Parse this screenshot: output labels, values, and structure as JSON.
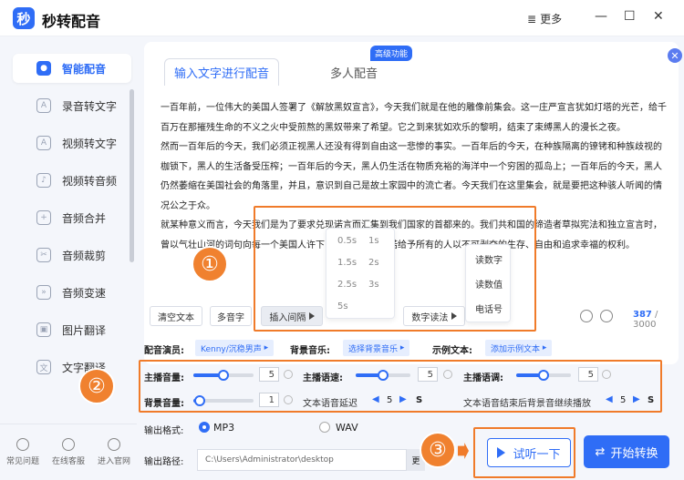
{
  "app": {
    "title": "秒转配音",
    "logo_char": "秒",
    "more_label": "更多",
    "win_min": "—",
    "win_max": "☐",
    "win_close": "✕"
  },
  "sidebar": {
    "items": [
      {
        "label": "智能配音",
        "active": true
      },
      {
        "label": "录音转文字"
      },
      {
        "label": "视频转文字"
      },
      {
        "label": "视频转音频"
      },
      {
        "label": "音频合并"
      },
      {
        "label": "音频裁剪"
      },
      {
        "label": "音频变速"
      },
      {
        "label": "图片翻译"
      },
      {
        "label": "文字翻译"
      }
    ],
    "bottom": [
      "常见问题",
      "在线客服",
      "进入官网"
    ]
  },
  "tabs": {
    "input_text": "输入文字进行配音",
    "multi": "多人配音",
    "badge": "高级功能"
  },
  "body_text": [
    "一百年前，一位伟大的美国人签署了《解放黑奴宣言》，今天我们就是在他的雕像前集会。这一庄严宣言犹如灯塔的光芒，给千百万在那摧残生命的不义之火中受煎熬的黑奴带来了希望。它之到来犹如欢乐的黎明，结束了束缚黑人的漫长之夜。",
    "然而一百年后的今天，我们必须正视黑人还没有得到自由这一悲惨的事实。一百年后的今天，在种族隔离的镣铐和种族歧视的枷锁下，黑人的生活备受压榨；一百年后的今天，黑人仍生活在物质充裕的海洋中一个穷困的孤岛上；一百年后的今天，黑人仍然萎缩在美国社会的角落里，并且，意识到自己是故土家园中的流亡者。今天我们在这里集会，就是要把这种骇人听闻的情况公之于众。",
    "就某种意义而言，今天我们是为了要求兑现诺言而汇集到我们国家的首都来的。我们共和国的缔造者草拟宪法和独立宣言时，曾以气壮山河的词句向每一个美国人许下了诺言。他们承诺给予所有的人以不可剥夺的生存、自由和追求幸福的权利。"
  ],
  "toolbar": {
    "clear": "清空文本",
    "polyphone": "多音字",
    "insert_pause": "插入间隔",
    "number_read": "数字读法",
    "counter_used": "387",
    "counter_max": " / 3000"
  },
  "pause_options": [
    "0.5s",
    "1s",
    "1.5s",
    "2s",
    "2.5s",
    "3s",
    "5s"
  ],
  "number_options": [
    "读数字",
    "读数值",
    "电话号"
  ],
  "settings": {
    "voice_label": "配音演员:",
    "voice_value": "Kenny/沉稳男声",
    "bgm_label": "背景音乐:",
    "bgm_value": "选择背景音乐",
    "sample_label": "示例文本:",
    "sample_value": "添加示例文本",
    "anchor_volume_label": "主播音量:",
    "anchor_volume": "5",
    "anchor_volume_level": 0.5,
    "anchor_speed_label": "主播语速:",
    "anchor_speed": "5",
    "anchor_speed_level": 0.5,
    "anchor_pitch_label": "主播语调:",
    "anchor_pitch": "5",
    "anchor_pitch_level": 0.5,
    "bg_volume_label": "背景音量:",
    "bg_volume": "1",
    "bg_volume_level": 0.1,
    "delay_label": "文本语音延迟",
    "delay_value": "5",
    "delay_unit": "S",
    "tail_label": "文本语音结束后背景音继续播放",
    "tail_value": "5",
    "tail_unit": "S"
  },
  "output": {
    "format_label": "输出格式:",
    "mp3": "MP3",
    "wav": "WAV",
    "path_label": "输出路径:",
    "path_value": "C:\\Users\\Administrator\\desktop",
    "change_btn": "更"
  },
  "actions": {
    "listen": "试听一下",
    "start": "开始转换"
  },
  "annotations": [
    "①",
    "②",
    "③"
  ],
  "colors": {
    "accent": "#2f6df6",
    "annotation": "#f07b2a"
  }
}
